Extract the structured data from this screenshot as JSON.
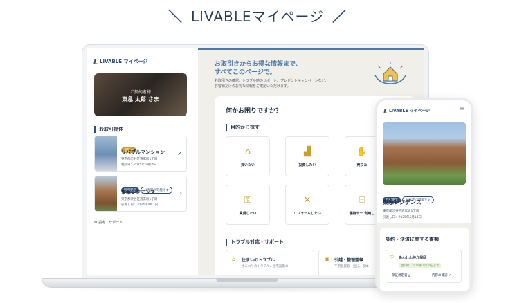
{
  "headline": "LIVABLEマイページ",
  "app": {
    "logo": "LIVABLE マイページ"
  },
  "sidebar": {
    "profile": {
      "role": "ご契約者様",
      "name": "東急 太郎 さま"
    },
    "section_title": "お取引物件",
    "properties": [
      {
        "badges": [
          "相談中"
        ],
        "name": "リバブルマンション",
        "address": "東京都渋谷区道玄坂1丁目",
        "date": "相談日：2025年5月14日"
      },
      {
        "badges": [
          "取引完了",
          "AI査定が可能です"
        ],
        "name": "東急レジデンス",
        "address": "東京都渋谷区道玄坂1丁目",
        "date": "引渡し日：2024年4月1日"
      }
    ],
    "settings": "設定・サポート"
  },
  "main": {
    "hero_line1": "お取引きからお得な情報まで、",
    "hero_line2": "すべてこのページで。",
    "hero_sub1": "お取引きの確認、トラブル時のサポート、プレゼントキャンペーンなど、",
    "hero_sub2": "お客様だけのお得な情報をご確認いただけます。",
    "panel_title": "何かお困りですか？",
    "purpose_title": "目的から探す",
    "purposes": [
      {
        "icon": "house-search-icon",
        "label": "買いたい"
      },
      {
        "icon": "chart-up-icon",
        "label": "投資したい"
      },
      {
        "icon": "hand-house-icon",
        "label": "売りた"
      },
      {
        "icon": "key-hand-icon",
        "label": "賃貸したい"
      },
      {
        "icon": "tools-icon",
        "label": "リフォームしたい"
      },
      {
        "icon": "gift-icon",
        "label": "優待サー 利用し"
      }
    ],
    "trouble_title": "トラブル対応・サポート",
    "troubles": [
      {
        "title": "住まいのトラブル",
        "desc": "水まわりのトラブル、住宅設備の"
      },
      {
        "title": "引越・整理整頓",
        "desc": "不用品買取・処分、収納"
      }
    ]
  },
  "phone": {
    "logo": "LIVABLE マイページ",
    "badges": [
      "取引完了",
      "AI査定が可能です"
    ],
    "name": "東急レジデンス",
    "address": "東京都渋谷区道玄坂1丁目",
    "date": "引渡し日：2025年5月14日",
    "card_title": "契約・決済に関する書類",
    "doc_title": "あんしん仲介保証",
    "doc_badge": "加入中：2025年 4月20日まで",
    "doc_btn1": "保証規定書",
    "doc_btn2": "内容の確認"
  }
}
